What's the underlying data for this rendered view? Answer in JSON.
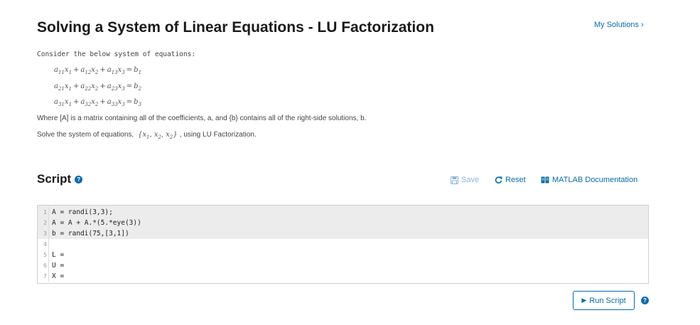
{
  "header": {
    "title": "Solving a System of Linear Equations - LU Factorization",
    "my_solutions": "My Solutions",
    "my_solutions_chevron": "›"
  },
  "problem": {
    "intro": "Consider the below system of equations:",
    "equations": [
      {
        "t1": "a",
        "s1": "11",
        "x1": "x",
        "xs1": "1",
        "t2": "a",
        "s2": "12",
        "x2": "x",
        "xs2": "2",
        "t3": "a",
        "s3": "13",
        "x3": "x",
        "xs3": "3",
        "rhs": "b",
        "rs": "1"
      },
      {
        "t1": "a",
        "s1": "21",
        "x1": "x",
        "xs1": "1",
        "t2": "a",
        "s2": "22",
        "x2": "x",
        "xs2": "2",
        "t3": "a",
        "s3": "23",
        "x3": "x",
        "xs3": "3",
        "rhs": "b",
        "rs": "2"
      },
      {
        "t1": "a",
        "s1": "31",
        "x1": "x",
        "xs1": "1",
        "t2": "a",
        "s2": "32",
        "x2": "x",
        "xs2": "2",
        "t3": "a",
        "s3": "33",
        "x3": "x",
        "xs3": "3",
        "rhs": "b",
        "rs": "3"
      }
    ],
    "where_text": "Where [A] is a matrix containing all of the coefficients, a, and {b} contains all of the right-side solutions, b.",
    "solve_prefix": "Solve the system of equations,",
    "solve_set": {
      "open": "{",
      "v": "x",
      "s1": "1",
      "s2": "2",
      "s3": "2",
      "close": "}"
    },
    "solve_suffix": ", using LU Factorization."
  },
  "script": {
    "heading": "Script",
    "help_glyph": "?",
    "toolbar": {
      "save_label": "Save",
      "reset_label": "Reset",
      "doc_label": "MATLAB Documentation"
    },
    "lines": [
      {
        "num": "1",
        "code": "A = randi(3,3);",
        "locked": true
      },
      {
        "num": "2",
        "code": "A = A + A.*(5.*eye(3))",
        "locked": true
      },
      {
        "num": "3",
        "code": "b = randi(75,[3,1])",
        "locked": true
      },
      {
        "num": "4",
        "code": "",
        "locked": false
      },
      {
        "num": "5",
        "code": "L =",
        "locked": false
      },
      {
        "num": "6",
        "code": "U =",
        "locked": false
      },
      {
        "num": "7",
        "code": "X =",
        "locked": false
      }
    ],
    "run_label": "Run Script",
    "run_glyph": "▶"
  },
  "colors": {
    "link": "#0b6aa6",
    "disabled": "#8cb4d3",
    "locked_line_bg": "#ececec"
  }
}
